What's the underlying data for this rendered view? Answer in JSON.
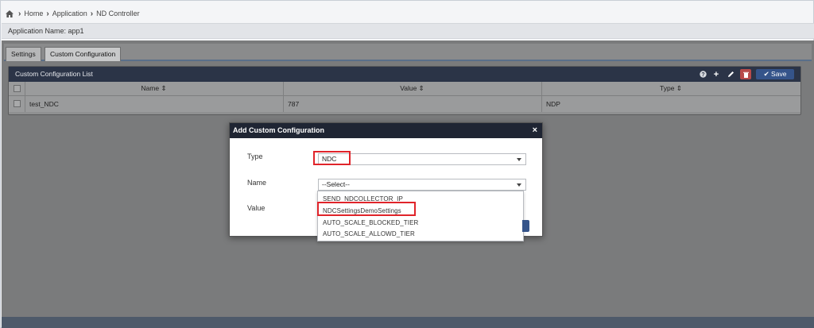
{
  "breadcrumb": {
    "items": [
      "Home",
      "Application",
      "ND Controller"
    ]
  },
  "app": {
    "name_label": "Application Name: app1"
  },
  "tabs": [
    {
      "label": "Settings",
      "active": false
    },
    {
      "label": "Custom Configuration",
      "active": true
    }
  ],
  "list": {
    "title": "Custom Configuration List",
    "save_label": "✔ Save",
    "columns": [
      {
        "label": "Name ⇕"
      },
      {
        "label": "Value ⇕"
      },
      {
        "label": "Type ⇕"
      }
    ],
    "rows": [
      {
        "name": "test_NDC",
        "value": "787",
        "type": "NDP"
      }
    ]
  },
  "modal": {
    "title": "Add Custom Configuration",
    "close": "×",
    "type_label": "Type",
    "type_value": "NDC",
    "name_label": "Name",
    "name_value": "--Select--",
    "value_label": "Value"
  },
  "dropdown": {
    "options": [
      "SEND_NDCOLLECTOR_IP",
      "NDCSettingsDemoSettings",
      "AUTO_SCALE_BLOCKED_TIER",
      "AUTO_SCALE_ALLOWD_TIER"
    ]
  },
  "icons": {
    "home": "home-icon",
    "help": "help-icon",
    "add": "plus-icon",
    "edit": "pencil-icon",
    "delete": "trash-icon"
  },
  "colors": {
    "header_dark": "#1f2533",
    "panel_head": "#2b3447",
    "accent": "#35548a",
    "delete": "#b84a4a",
    "highlight": "#e0242a"
  }
}
